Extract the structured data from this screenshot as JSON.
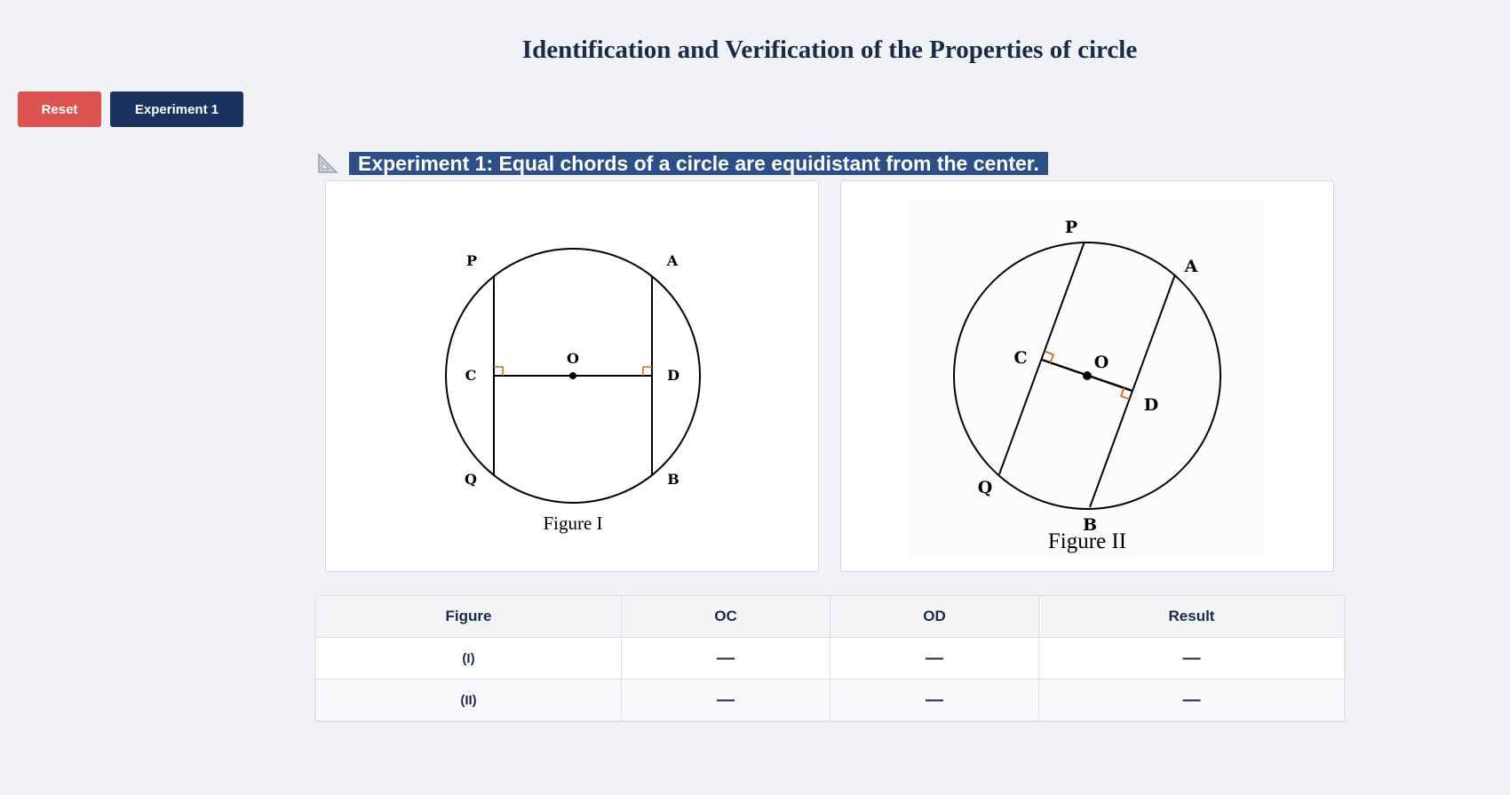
{
  "header": {
    "title": "Identification and Verification of the Properties of circle"
  },
  "toolbar": {
    "reset_label": "Reset",
    "experiment_label": "Experiment 1"
  },
  "experiment": {
    "icon": "set-square-icon",
    "title": "Experiment 1: Equal chords of a circle are equidistant from the center."
  },
  "figures": [
    {
      "caption": "Figure I",
      "points": {
        "P": "P",
        "A": "A",
        "O": "O",
        "C": "C",
        "D": "D",
        "Q": "Q",
        "B": "B"
      }
    },
    {
      "caption": "Figure II",
      "points": {
        "P": "P",
        "A": "A",
        "O": "O",
        "C": "C",
        "D": "D",
        "Q": "Q",
        "B": "B"
      }
    }
  ],
  "colors": {
    "right_angle_marker": "#d2691e",
    "accent": "#1a3260",
    "reset": "#dc5350"
  },
  "table": {
    "headers": [
      "Figure",
      "OC",
      "OD",
      "Result"
    ],
    "rows": [
      [
        "(I)",
        "—",
        "—",
        "—"
      ],
      [
        "(II)",
        "—",
        "—",
        "—"
      ]
    ]
  }
}
